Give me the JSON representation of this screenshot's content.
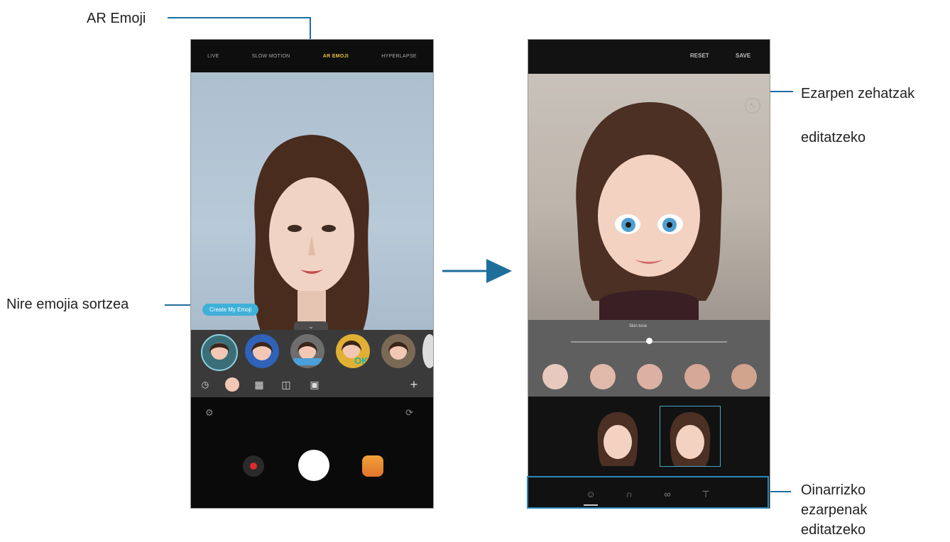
{
  "callouts": {
    "ar_emoji": "AR Emoji",
    "create_my_emoji": "Nire emojia sortzea",
    "detailed_settings_line1": "Ezarpen zehatzak",
    "detailed_settings_line2": "editatzeko",
    "basic_settings_line1": "Oinarrizko",
    "basic_settings_line2": "ezarpenak",
    "basic_settings_line3": "editatzeko"
  },
  "camera_screen": {
    "modes": [
      "LIVE",
      "SLOW MOTION",
      "AR EMOJI",
      "HYPERLAPSE"
    ],
    "active_mode": "AR EMOJI",
    "create_pill_label": "Create My Emoji",
    "tray_handle": "⌄",
    "add_label": "+",
    "icons": {
      "settings": "gear-icon",
      "switch_camera": "switch-camera-icon",
      "record": "record-icon",
      "shutter": "shutter-icon",
      "gallery": "gallery-icon",
      "recent": "clock-icon"
    }
  },
  "editor_screen": {
    "reset_label": "RESET",
    "save_label": "SAVE",
    "slider_label": "Skin tone",
    "skin_colors": [
      "#e8c9bd",
      "#e0b9aa",
      "#dcb1a3",
      "#d6a898",
      "#d1a48e"
    ],
    "selected_preset_index": 1,
    "tabs": [
      "face-icon",
      "hair-icon",
      "glasses-icon",
      "shirt-icon"
    ],
    "active_tab": 0
  },
  "colors": {
    "callout_line": "#1e6e9c",
    "active_mode": "#e6c23a",
    "create_pill": "#3fb0d8"
  }
}
